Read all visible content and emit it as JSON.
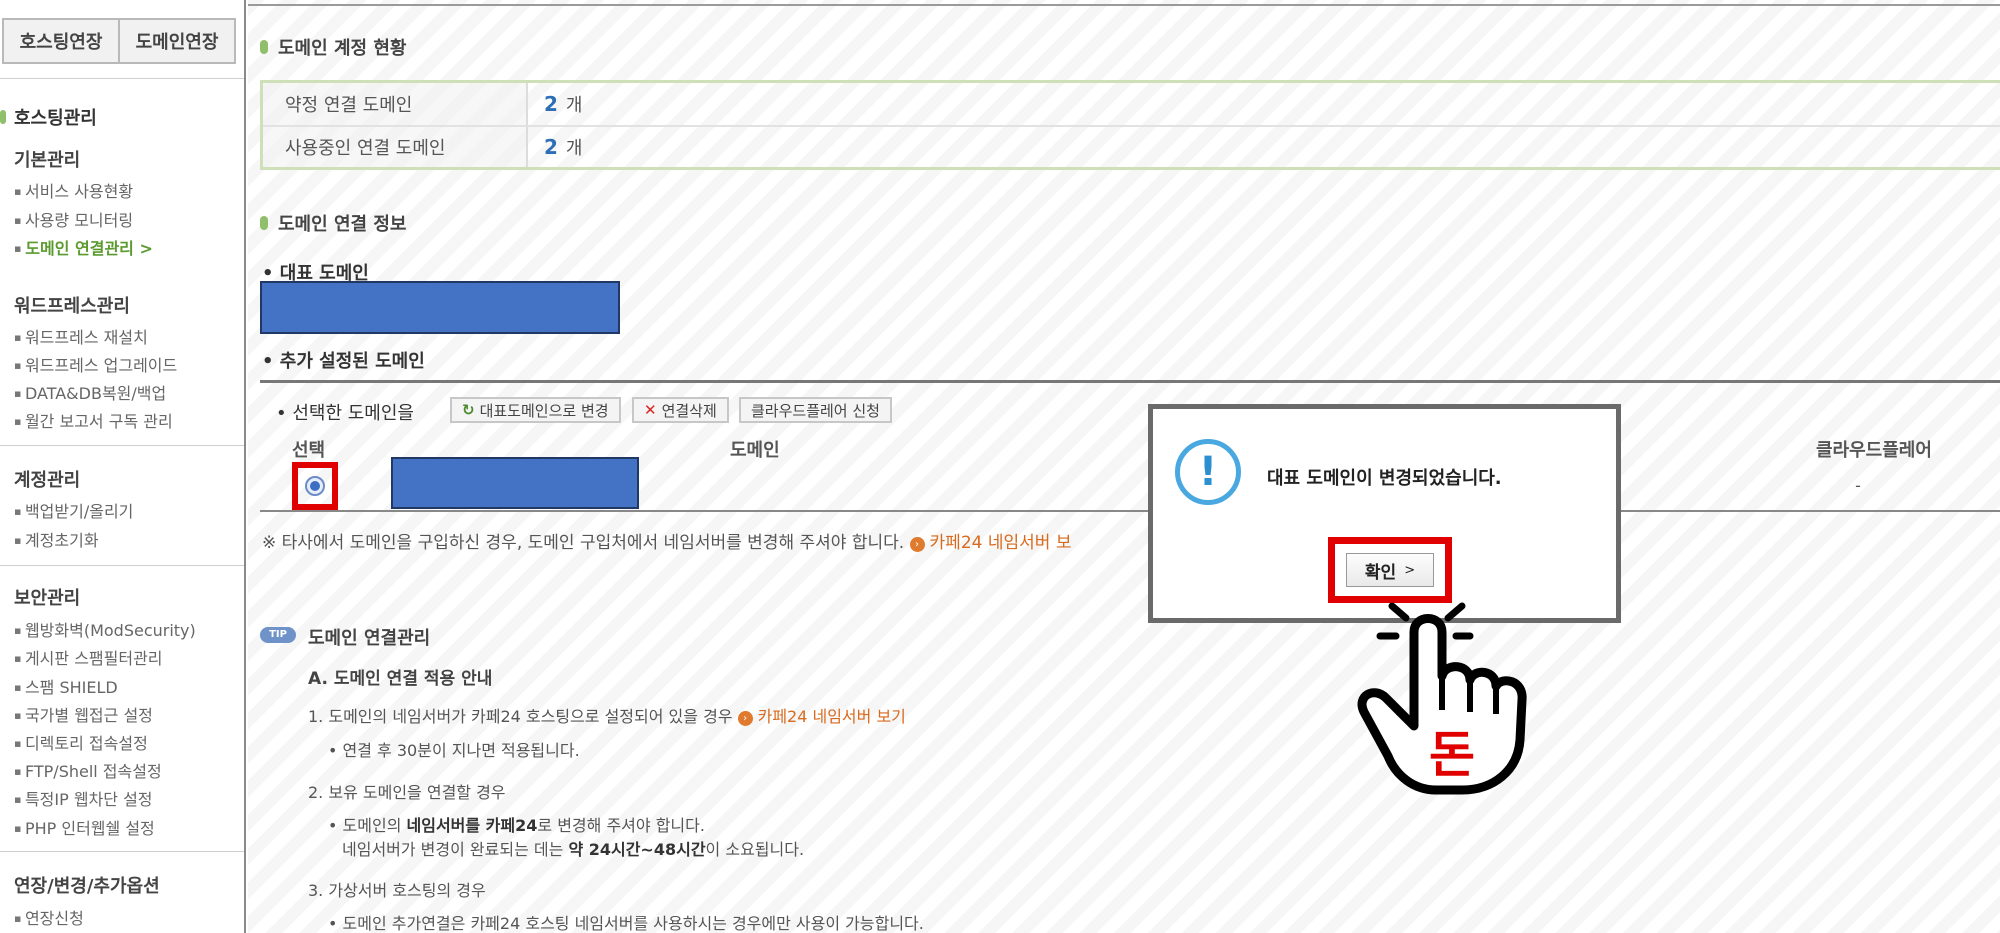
{
  "sidebar": {
    "tabs": [
      "호스팅연장",
      "도메인연장"
    ],
    "main_title": "호스팅관리",
    "groups": [
      {
        "title": "기본관리",
        "items": [
          "서비스 사용현황",
          "사용량 모니터링",
          "도메인 연결관리"
        ]
      },
      {
        "title": "워드프레스관리",
        "items": [
          "워드프레스 재설치",
          "워드프레스 업그레이드",
          "DATA&DB복원/백업",
          "월간 보고서 구독 관리"
        ]
      },
      {
        "title": "계정관리",
        "items": [
          "백업받기/올리기",
          "계정초기화"
        ]
      },
      {
        "title": "보안관리",
        "items": [
          "웹방화벽(ModSecurity)",
          "게시판 스팸필터관리",
          "스팸 SHIELD",
          "국가별 웹접근 설정",
          "디렉토리 접속설정",
          "FTP/Shell 접속설정",
          "특정IP 웹차단 설정",
          "PHP 인터웹쉘 설정"
        ]
      },
      {
        "title": "연장/변경/추가옵션",
        "items": [
          "연장신청"
        ]
      }
    ],
    "active_arrow": ">"
  },
  "status": {
    "title": "도메인 계정 현황",
    "rows": [
      {
        "label": "약정 연결 도메인",
        "count": "2",
        "unit": "개"
      },
      {
        "label": "사용중인 연결 도메인",
        "count": "2",
        "unit": "개"
      }
    ]
  },
  "connection": {
    "title": "도메인 연결 정보",
    "primary_label": "대표 도메인",
    "additional_label": "추가 설정된 도메인",
    "selected_label": "선택한 도메인을",
    "buttons": {
      "make_primary": "대표도메인으로 변경",
      "delete": "연결삭제",
      "cloudflare": "클라우드플레어 신청"
    },
    "columns": {
      "select": "선택",
      "domain": "도메인",
      "cloudflare": "클라우드플레어"
    },
    "row_cloudflare": "-",
    "notice": "※ 타사에서 도메인을 구입하신 경우, 도메인 구입처에서 네임서버를 변경해 주셔야 합니다.",
    "notice_link": "카페24 네임서버 보"
  },
  "tip": {
    "badge": "TIP",
    "title": "도메인 연결관리",
    "heading_a": "A. 도메인 연결 적용 안내",
    "item1": "1. 도메인의 네임서버가 카페24 호스팅으로 설정되어 있을 경우",
    "item1_link": "카페24 네임서버 보기",
    "item1_sub": "연결 후 30분이 지나면 적용됩니다.",
    "item2": "2. 보유 도메인을 연결할 경우",
    "item2_sub_a": "도메인의 ",
    "item2_sub_b": "네임서버를 카페24",
    "item2_sub_c": "로 변경해 주셔야 합니다.",
    "item2_sub2_a": "네임서버가 변경이 완료되는 데는 ",
    "item2_sub2_b": "약 24시간~48시간",
    "item2_sub2_c": "이 소요됩니다.",
    "item3": "3. 가상서버 호스팅의 경우",
    "item3_sub": "도메인 추가연결은 카페24 호스팅 네임서버를 사용하시는 경우에만 사용이 가능합니다."
  },
  "dialog": {
    "icon": "!",
    "message": "대표 도메인이 변경되었습니다.",
    "ok_label": "확인",
    "ok_chevron": ">"
  },
  "overlay": {
    "hand_text": "돈"
  },
  "colors": {
    "accent_green": "#8fbf6a",
    "highlight_red": "#e00000",
    "redaction_blue": "#4472c4",
    "link_orange": "#d86a1e"
  }
}
